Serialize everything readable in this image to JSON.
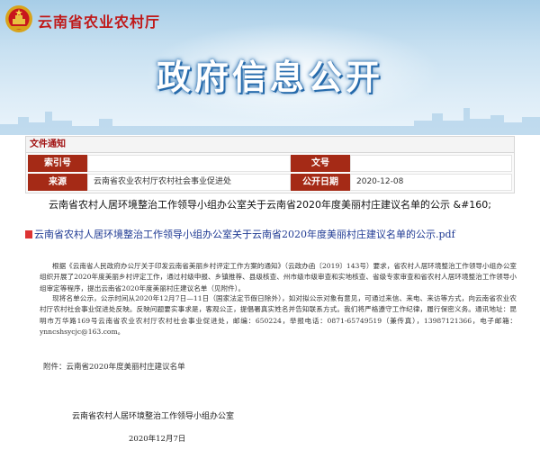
{
  "header": {
    "site_name": "云南省农业农村厅",
    "banner_title": "政府信息公开",
    "emblem_icon": "national-emblem-icon",
    "brand_color": "#c01818"
  },
  "info_panel": {
    "heading": "文件通知",
    "rows": [
      {
        "label1": "索引号",
        "value1": "",
        "label2": "文号",
        "value2": ""
      },
      {
        "label1": "来源",
        "value1": "云南省农业农村厅农村社会事业促进处",
        "label2": "公开日期",
        "value2": "2020-12-08"
      }
    ],
    "label_color": "#a52a16"
  },
  "article": {
    "title": "云南省农村人居环境整治工作领导小组办公室关于云南省2020年度美丽村庄建议名单的公示 &#160;",
    "attachment_link": "云南省农村人居环境整治工作领导小组办公室关于云南省2020年度美丽村庄建议名单的公示.pdf",
    "paragraph1": "根据《云南省人民政府办公厅关于印发云南省美丽乡村评定工作方案的通知》（云政办函〔2019〕143号）要求，省农村人居环境整治工作领导小组办公室组织开展了2020年度美丽乡村评定工作，通过村级申报、乡镇推荐、县级核查、州市级市级审查和实地核查、省级专家审查和省农村人居环境整治工作领导小组审定等程序，提出云南省2020年度美丽村庄建议名单（见附件）。",
    "paragraph2": "现将名单公示，公示时间从2020年12月7日—11日（国家法定节假日除外），如对拟公示对象有意见，可通过来信、来电、来访等方式，向云南省农业农村厅农村社会事业促进处反映。反映问题要实事求是，客观公正，提倡署真实姓名并告知联系方式。我们将严格遵守工作纪律，履行保密义务。通讯地址：昆明市万华路169号云南省农业农村厅农村社会事业促进处，邮编：650224，举报电话：0871-65749519（兼传真），13987121366，电子邮箱：ynncshsycjc@163.com。",
    "attachment_line": "附件：云南省2020年度美丽村庄建议名单",
    "sign_org": "云南省农村人居环境整治工作领导小组办公室",
    "sign_date": "2020年12月7日",
    "link_color": "#1f3a93"
  }
}
